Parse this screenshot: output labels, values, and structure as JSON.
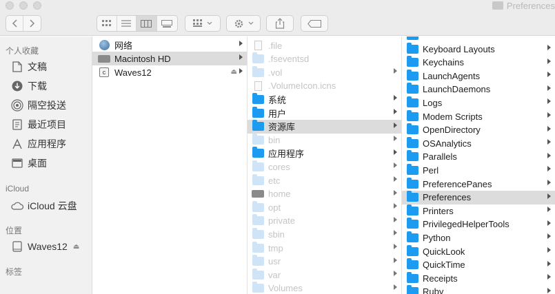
{
  "window": {
    "title": "Preferences"
  },
  "toolbar": {
    "icons": [
      "back-icon",
      "forward-icon",
      "icon-view-icon",
      "list-view-icon",
      "column-view-icon",
      "gallery-view-icon",
      "group-icon",
      "action-gear-icon",
      "share-icon",
      "tag-icon"
    ]
  },
  "sidebar": {
    "favorites_heading": "个人收藏",
    "favorites": [
      {
        "label": "文稿",
        "icon": "document-icon"
      },
      {
        "label": "下载",
        "icon": "download-icon"
      },
      {
        "label": "隔空投送",
        "icon": "airdrop-icon"
      },
      {
        "label": "最近项目",
        "icon": "recents-icon"
      },
      {
        "label": "应用程序",
        "icon": "applications-icon"
      },
      {
        "label": "桌面",
        "icon": "desktop-icon"
      }
    ],
    "icloud_heading": "iCloud",
    "icloud": [
      {
        "label": "iCloud 云盘",
        "icon": "cloud-icon"
      }
    ],
    "locations_heading": "位置",
    "locations": [
      {
        "label": "Waves12",
        "icon": "disk-icon"
      }
    ],
    "tags_heading": "标签"
  },
  "column1": [
    {
      "label": "网络",
      "icon": "network-icon",
      "chevron": true
    },
    {
      "label": "Macintosh HD",
      "icon": "hard-drive-icon",
      "chevron": true,
      "selected": true
    },
    {
      "label": "Waves12",
      "icon": "disk-icon",
      "chevron": true,
      "eject": true
    }
  ],
  "column2": [
    {
      "label": ".file",
      "dim": true,
      "icon": "file-icon"
    },
    {
      "label": ".fseventsd",
      "dim": true,
      "icon": "folder-icon"
    },
    {
      "label": ".vol",
      "dim": true,
      "icon": "folder-icon",
      "chevron": true
    },
    {
      "label": ".VolumeIcon.icns",
      "dim": true,
      "icon": "file-icon"
    },
    {
      "label": "系统",
      "icon": "folder-icon",
      "chevron": true
    },
    {
      "label": "用户",
      "icon": "folder-icon",
      "chevron": true
    },
    {
      "label": "资源库",
      "icon": "folder-icon",
      "chevron": true,
      "selected": true
    },
    {
      "label": "bin",
      "dim": true,
      "icon": "folder-icon",
      "chevron": true
    },
    {
      "label": "应用程序",
      "icon": "folder-icon",
      "chevron": true
    },
    {
      "label": "cores",
      "dim": true,
      "icon": "folder-icon",
      "chevron": true
    },
    {
      "label": "etc",
      "dim": true,
      "icon": "folder-icon",
      "chevron": true
    },
    {
      "label": "home",
      "dim": true,
      "icon": "drive-icon",
      "chevron": true
    },
    {
      "label": "opt",
      "dim": true,
      "icon": "folder-icon",
      "chevron": true
    },
    {
      "label": "private",
      "dim": true,
      "icon": "folder-icon",
      "chevron": true
    },
    {
      "label": "sbin",
      "dim": true,
      "icon": "folder-icon",
      "chevron": true
    },
    {
      "label": "tmp",
      "dim": true,
      "icon": "folder-icon",
      "chevron": true
    },
    {
      "label": "usr",
      "dim": true,
      "icon": "folder-icon",
      "chevron": true
    },
    {
      "label": "var",
      "dim": true,
      "icon": "folder-icon",
      "chevron": true
    },
    {
      "label": "Volumes",
      "dim": true,
      "icon": "folder-icon",
      "chevron": true
    }
  ],
  "column3": [
    {
      "label": "Keyboard Layouts",
      "chevron": true
    },
    {
      "label": "Keychains",
      "chevron": true
    },
    {
      "label": "LaunchAgents",
      "chevron": true
    },
    {
      "label": "LaunchDaemons",
      "chevron": true
    },
    {
      "label": "Logs",
      "chevron": true
    },
    {
      "label": "Modem Scripts",
      "chevron": true
    },
    {
      "label": "OpenDirectory",
      "chevron": true
    },
    {
      "label": "OSAnalytics",
      "chevron": true
    },
    {
      "label": "Parallels",
      "chevron": true
    },
    {
      "label": "Perl",
      "chevron": true
    },
    {
      "label": "PreferencePanes",
      "chevron": true
    },
    {
      "label": "Preferences",
      "chevron": true,
      "selected": true
    },
    {
      "label": "Printers",
      "chevron": true
    },
    {
      "label": "PrivilegedHelperTools",
      "chevron": true
    },
    {
      "label": "Python",
      "chevron": true
    },
    {
      "label": "QuickLook",
      "chevron": true
    },
    {
      "label": "QuickTime",
      "chevron": true
    },
    {
      "label": "Receipts",
      "chevron": true
    },
    {
      "label": "Ruby",
      "chevron": true
    }
  ]
}
